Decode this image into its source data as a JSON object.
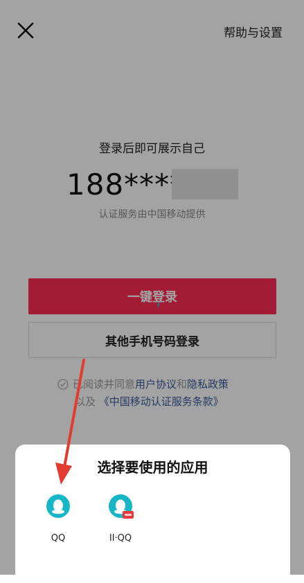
{
  "header": {
    "help_label": "帮助与设置"
  },
  "login": {
    "slogan": "登录后即可展示自己",
    "phone_masked": "188****",
    "provider_note": "认证服务由中国移动提供",
    "one_click_label": "一键登录",
    "other_phone_label": "其他手机号码登录"
  },
  "agreement": {
    "prefix": "已阅读并同意 ",
    "user_agreement": "用户协议",
    "and": " 和 ",
    "privacy_policy": "隐私政策",
    "line2_prefix": "以及 ",
    "cmcc_terms": "《中国移动认证服务条款》"
  },
  "chooser": {
    "title": "选择要使用的应用",
    "apps": [
      {
        "label": "QQ",
        "icon": "qq-icon"
      },
      {
        "label": "II·QQ",
        "icon": "qq-clone-icon"
      }
    ]
  },
  "colors": {
    "primary_button": "#fe2c55",
    "link": "#3a5a9a",
    "qq_teal": "#17b6c7",
    "annotation_arrow": "#e23b2f"
  }
}
